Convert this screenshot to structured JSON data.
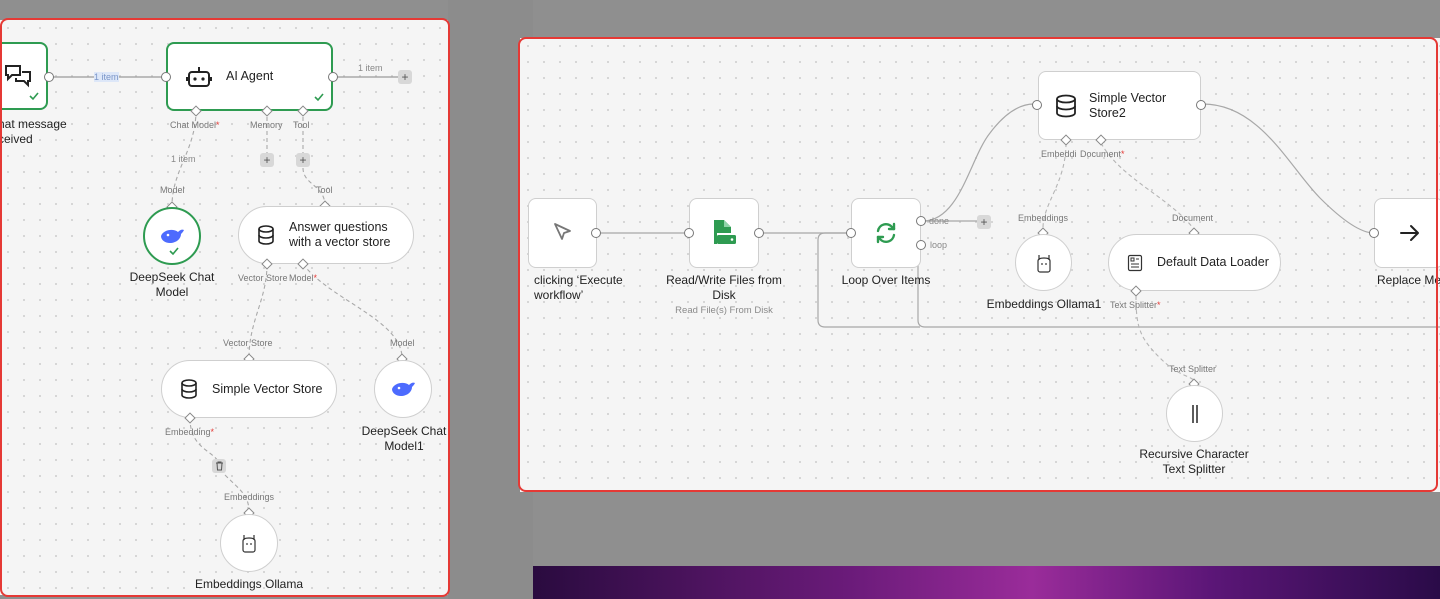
{
  "left": {
    "chat_node": {
      "label_line1": "hat message",
      "label_line2": "ceived"
    },
    "ai_agent": {
      "title": "AI Agent",
      "output_label": "1 item",
      "edge_in_label": "1 item"
    },
    "ports": {
      "chat_model": "Chat Model",
      "memory": "Memory",
      "tool": "Tool",
      "required_mark": "*"
    },
    "chat_model_edge_label": "1 item",
    "deepseek": {
      "port": "Model",
      "line1": "DeepSeek Chat",
      "line2": "Model"
    },
    "answer_tool": {
      "port": "Tool",
      "line1": "Answer questions",
      "line2": "with a vector store",
      "vector_store_port": "Vector Store",
      "model_port": "Model"
    },
    "simple_vector_store": {
      "port": "Vector Store",
      "title": "Simple Vector Store",
      "embedding_port": "Embedding"
    },
    "deepseek1": {
      "port": "Model",
      "line1": "DeepSeek Chat",
      "line2": "Model1"
    },
    "embeddings": {
      "port": "Embeddings",
      "title": "Embeddings Ollama"
    }
  },
  "right": {
    "trigger": {
      "line1": "clicking ‘Execute",
      "line2": "workflow’"
    },
    "read_write": {
      "line1": "Read/Write Files from",
      "line2": "Disk",
      "subtitle": "Read File(s) From Disk"
    },
    "loop": {
      "title": "Loop Over Items",
      "done": "done",
      "loop": "loop"
    },
    "vector_store2": {
      "line1": "Simple Vector",
      "line2": "Store2",
      "embedding_port": "Embeddi",
      "document_port": "Document"
    },
    "embeddings1": {
      "port": "Embeddings",
      "title": "Embeddings Ollama1"
    },
    "loader": {
      "port": "Document",
      "title": "Default Data Loader",
      "text_splitter_port": "Text Splitter"
    },
    "splitter": {
      "port": "Text Splitter",
      "line1": "Recursive Character",
      "line2": "Text Splitter"
    },
    "replace": {
      "title": "Replace Me"
    }
  },
  "colors": {
    "success": "#2e9b51",
    "highlight": "#e53935",
    "wire": "#b5b5b5"
  },
  "icons": [
    "chat-bubbles-icon",
    "robot-icon",
    "deepseek-whale-icon",
    "database-icon",
    "llama-icon",
    "cursor-icon",
    "file-drive-icon",
    "loop-arrows-icon",
    "document-loader-icon",
    "splitter-bars-icon",
    "arrow-right-icon",
    "trash-icon",
    "plus-icon",
    "check-icon"
  ]
}
